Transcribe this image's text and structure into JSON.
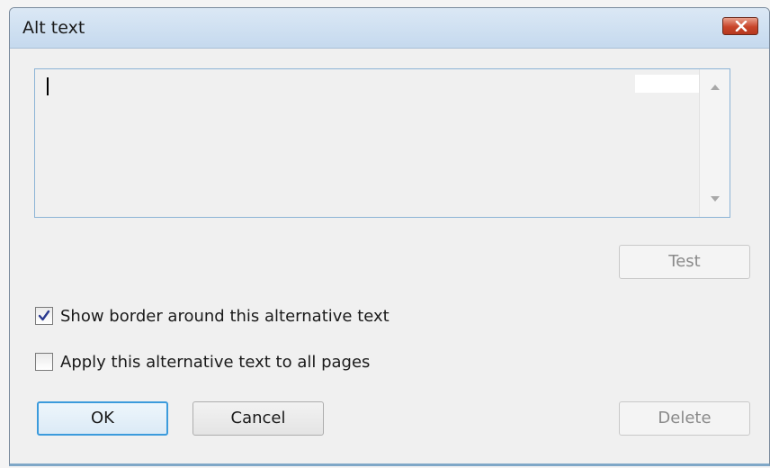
{
  "window": {
    "title": "Alt text"
  },
  "textarea": {
    "value": ""
  },
  "buttons": {
    "test": "Test",
    "ok": "OK",
    "cancel": "Cancel",
    "delete": "Delete"
  },
  "checkboxes": [
    {
      "label": "Show border around this alternative text",
      "checked": true
    },
    {
      "label": "Apply this alternative text to all pages",
      "checked": false
    }
  ],
  "icons": {
    "close": "close-icon",
    "scroll_up": "scroll-up-arrow-icon",
    "scroll_down": "scroll-down-arrow-icon",
    "checkmark": "checkmark-icon"
  },
  "colors": {
    "titlebar": "#c5d9ee",
    "close_button": "#c8452a",
    "default_button_border": "#3c9bdc",
    "textarea_border": "#8cb4d6"
  }
}
